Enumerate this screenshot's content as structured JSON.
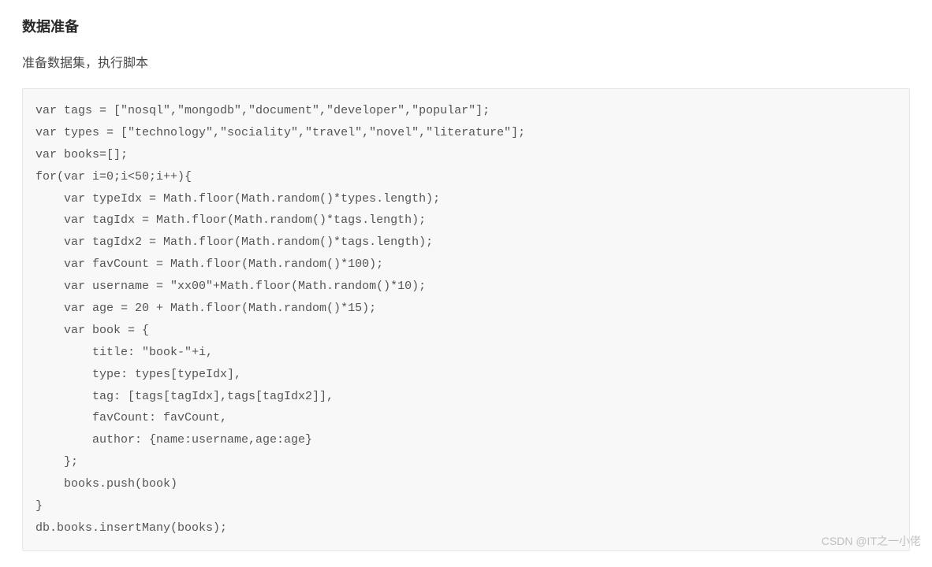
{
  "section": {
    "title": "数据准备",
    "subtitle": "准备数据集，执行脚本"
  },
  "code": "var tags = [\"nosql\",\"mongodb\",\"document\",\"developer\",\"popular\"];\nvar types = [\"technology\",\"sociality\",\"travel\",\"novel\",\"literature\"];\nvar books=[];\nfor(var i=0;i<50;i++){\n    var typeIdx = Math.floor(Math.random()*types.length);\n    var tagIdx = Math.floor(Math.random()*tags.length);\n    var tagIdx2 = Math.floor(Math.random()*tags.length);\n    var favCount = Math.floor(Math.random()*100);\n    var username = \"xx00\"+Math.floor(Math.random()*10);\n    var age = 20 + Math.floor(Math.random()*15);\n    var book = {\n        title: \"book-\"+i,\n        type: types[typeIdx],\n        tag: [tags[tagIdx],tags[tagIdx2]],\n        favCount: favCount,\n        author: {name:username,age:age}\n    };\n    books.push(book)\n}\ndb.books.insertMany(books);",
  "watermark": {
    "main": "CSDN @IT之一小佬",
    "sub": ""
  }
}
